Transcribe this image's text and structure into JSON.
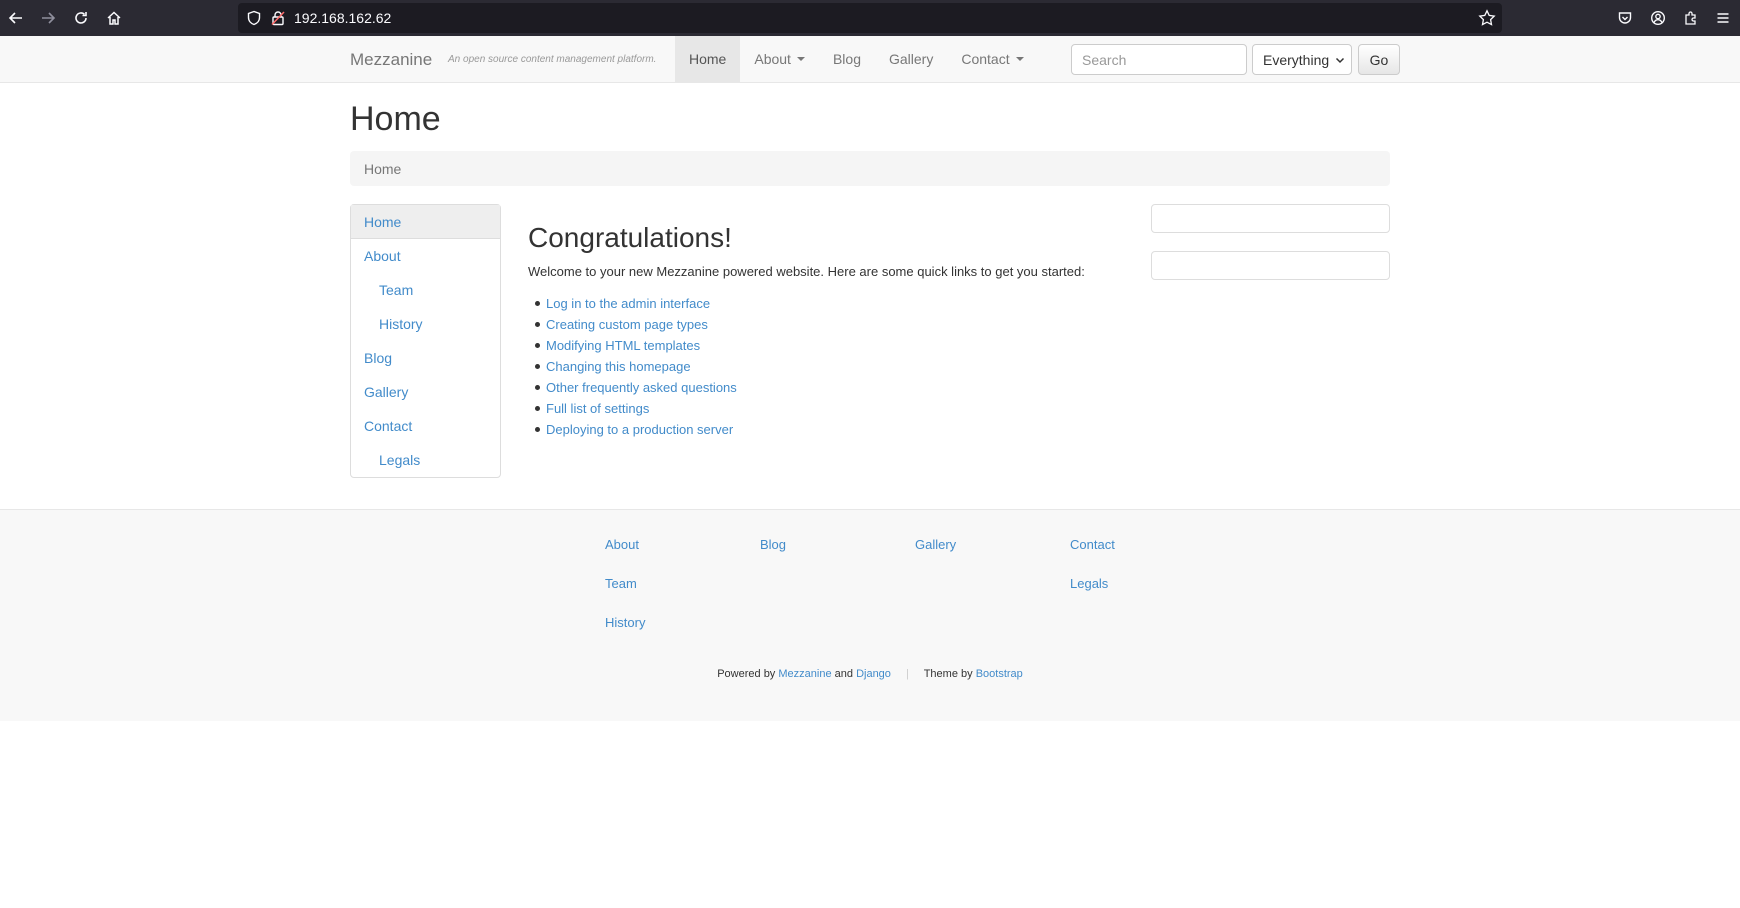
{
  "browser": {
    "url": "192.168.162.62"
  },
  "navbar": {
    "brand": "Mezzanine",
    "tagline": "An open source content management platform.",
    "items": [
      {
        "label": "Home",
        "active": true,
        "dropdown": false
      },
      {
        "label": "About",
        "active": false,
        "dropdown": true
      },
      {
        "label": "Blog",
        "active": false,
        "dropdown": false
      },
      {
        "label": "Gallery",
        "active": false,
        "dropdown": false
      },
      {
        "label": "Contact",
        "active": false,
        "dropdown": true
      }
    ],
    "search_placeholder": "Search",
    "search_scope": "Everything",
    "go_label": "Go"
  },
  "page": {
    "title": "Home",
    "breadcrumb": "Home"
  },
  "leftnav": {
    "items": [
      {
        "label": "Home",
        "child": false,
        "active": true
      },
      {
        "label": "About",
        "child": false,
        "active": false
      },
      {
        "label": "Team",
        "child": true,
        "active": false
      },
      {
        "label": "History",
        "child": true,
        "active": false
      },
      {
        "label": "Blog",
        "child": false,
        "active": false
      },
      {
        "label": "Gallery",
        "child": false,
        "active": false
      },
      {
        "label": "Contact",
        "child": false,
        "active": false
      },
      {
        "label": "Legals",
        "child": true,
        "active": false
      }
    ]
  },
  "main": {
    "heading": "Congratulations!",
    "welcome": "Welcome to your new Mezzanine powered website. Here are some quick links to get you started:",
    "links": [
      "Log in to the admin interface",
      "Creating custom page types",
      "Modifying HTML templates",
      "Changing this homepage",
      "Other frequently asked questions",
      "Full list of settings",
      "Deploying to a production server"
    ]
  },
  "footer": {
    "columns": [
      [
        "About",
        "Team",
        "History"
      ],
      [
        "Blog"
      ],
      [
        "Gallery"
      ],
      [
        "Contact",
        "Legals"
      ]
    ],
    "powered_by": "Powered by",
    "mezzanine": "Mezzanine",
    "and": "and",
    "django": "Django",
    "theme_by": "Theme by",
    "bootstrap": "Bootstrap"
  },
  "icons": {
    "back": "arrow-left-icon",
    "forward": "arrow-right-icon",
    "reload": "reload-icon",
    "home": "home-icon",
    "shield": "shield-icon",
    "lock": "lock-icon",
    "star": "star-icon",
    "pocket": "pocket-icon",
    "account": "account-icon",
    "extensions": "extensions-icon",
    "menu": "hamburger-menu-icon"
  },
  "colors": {
    "link": "#428bca",
    "chrome": "#2b2a33",
    "navbar": "#f8f8f8"
  }
}
